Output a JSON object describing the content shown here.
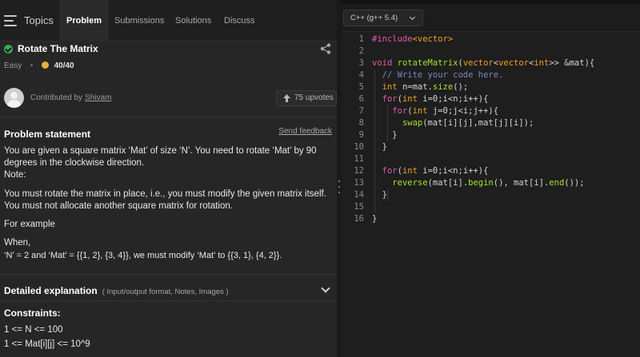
{
  "tabs": {
    "topics_label": "Topics",
    "items": [
      "Problem",
      "Submissions",
      "Solutions",
      "Discuss"
    ]
  },
  "problem": {
    "title": "Rotate The Matrix",
    "difficulty": "Easy",
    "score": "40/40",
    "contributed_by": "Contributed by",
    "contributor": "Shivam",
    "upvotes": "75 upvotes"
  },
  "statement": {
    "heading": "Problem statement",
    "feedback_link": "Send feedback",
    "paragraphs": [
      "You are given a square matrix ‘Mat’ of size ‘N’. You need to rotate ‘Mat’ by 90 degrees in the clockwise direction.",
      "Note:",
      "You must rotate the matrix in place, i.e., you must modify the given matrix itself. You must not allocate another square matrix for rotation.",
      "For example",
      "When,",
      "‘N’ = 2 and ‘Mat’ = {{1, 2}, {3, 4}}, we must modify ‘Mat’ to {{3, 1}, {4, 2}}."
    ]
  },
  "detail": {
    "title": "Detailed explanation",
    "subtitle": "( Input/output format, Notes, Images )"
  },
  "constraints": {
    "title": "Constraints:",
    "lines": [
      "1 <= N <= 100",
      "1 <= Mat[i][j] <= 10^9"
    ]
  },
  "editor": {
    "language": "C++ (g++ 5.4)",
    "line_numbers": [
      "1",
      "2",
      "3",
      "4",
      "5",
      "6",
      "7",
      "8",
      "9",
      "10",
      "11",
      "12",
      "13",
      "14",
      "15",
      "16"
    ],
    "code_lines": [
      "#include<vector>",
      "",
      "void rotateMatrix(vector<vector<int>> &mat){",
      "  // Write your code here.",
      "  int n=mat.size();",
      "  for(int i=0;i<n;i++){",
      "    for(int j=0;j<i;j++){",
      "      swap(mat[i][j],mat[j][i]);",
      "    }",
      "  }",
      "",
      "  for(int i=0;i<n;i++){",
      "    reverse(mat[i].begin(), mat[i].end());",
      "  }",
      "",
      "}"
    ]
  },
  "colors": {
    "keyword": "#e15aa8",
    "type": "#f0a020",
    "function": "#a6e22e",
    "comment": "#7a86c4",
    "success": "#3aa85a",
    "coin": "#e3b23c"
  }
}
